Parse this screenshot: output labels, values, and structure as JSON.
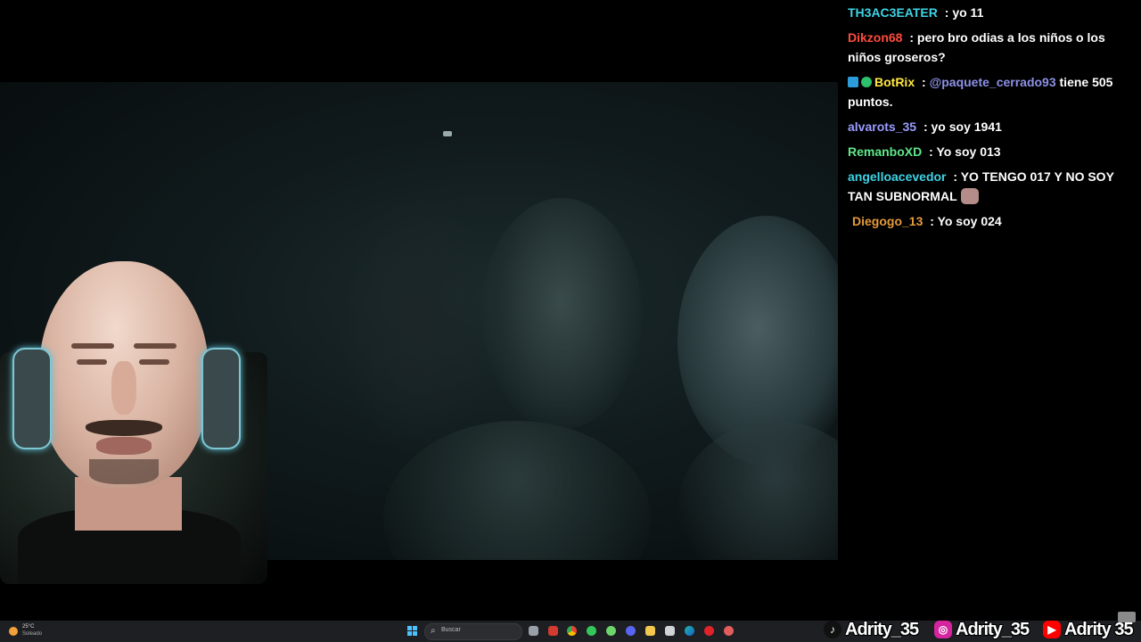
{
  "colors": {
    "tiktok": "#111111",
    "instagram": "#d6249f",
    "youtube": "#ff0000",
    "start_button": "#4cc2ff"
  },
  "chat": {
    "messages": [
      {
        "user": "TH3AC3EATER",
        "sep": " : ",
        "text": "yo 11",
        "color": "#3ed3e6"
      },
      {
        "user": "Dikzon68",
        "sep": " : ",
        "text": "pero bro odias a los niños o los niños groseros?",
        "color": "#ff4b3e"
      },
      {
        "user": "BotRix",
        "sep": " : ",
        "mention": "@paquete_cerrado93",
        "text": " tiene 505 puntos.",
        "color": "#ffe83d",
        "badges": [
          "bot-badge",
          "verified-badge"
        ]
      },
      {
        "user": "alvarots_35",
        "sep": " : ",
        "text": "yo soy 1941",
        "color": "#9b9cff"
      },
      {
        "user": "RemanboXD",
        "sep": " : ",
        "text": "Yo soy 013",
        "color": "#5ee88a"
      },
      {
        "user": "angelloacevedor",
        "sep": " : ",
        "text": "YO TENGO 017 Y NO SOY TAN SUBNORMAL",
        "color": "#3ed3e6",
        "emote": "cat-emote"
      },
      {
        "user": "Diegogo_13",
        "sep": " : ",
        "text": "Yo soy 024",
        "color": "#e39a3b"
      }
    ]
  },
  "taskbar": {
    "weather_temp": "25°C",
    "weather_condition": "Soleado",
    "search_placeholder": "Buscar",
    "icons": [
      "task-view-icon",
      "app-red-icon",
      "chrome-icon",
      "app-green-icon",
      "app-green2-icon",
      "discord-icon",
      "folder-icon",
      "app-dark-icon",
      "edge-icon",
      "opera-icon",
      "app-red2-icon"
    ]
  },
  "socials": {
    "tiktok": "Adrity_35",
    "instagram": "Adrity_35",
    "youtube": "Adrity 35"
  }
}
